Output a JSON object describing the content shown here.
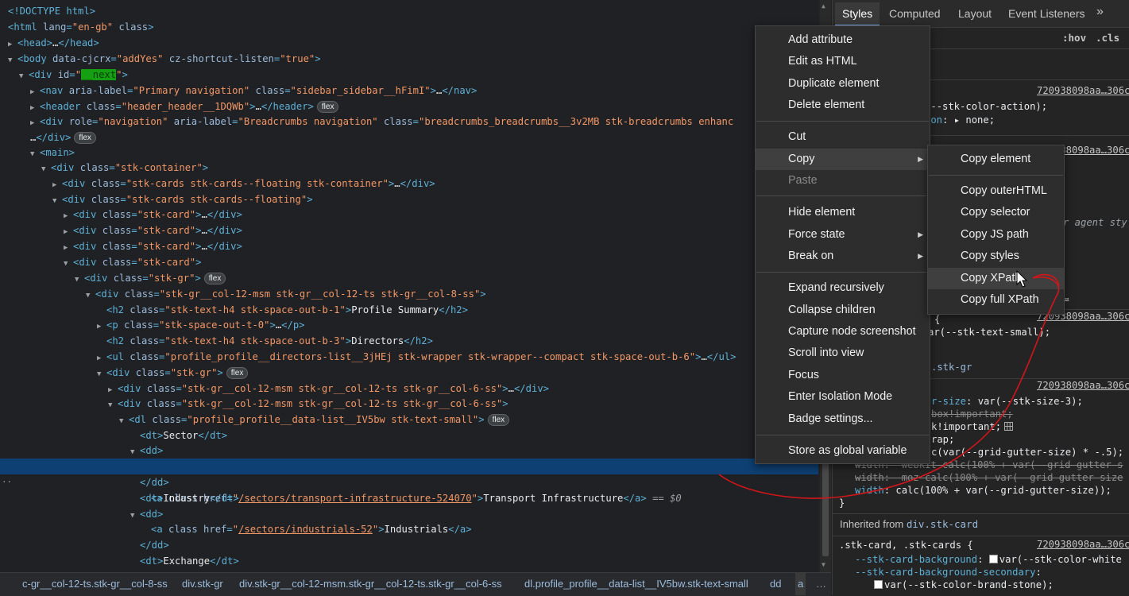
{
  "elements": {
    "lines": [
      {
        "t": "<!DOCTYPE html>"
      },
      {
        "t": "<html lang=\"en-gb\" class>"
      },
      {
        "t": "<head>…</head>"
      },
      {
        "t": "<body data-cjcrx=\"addYes\" cz-shortcut-listen=\"true\">"
      },
      {
        "t": "<div id=\"__next\">"
      },
      {
        "t": "<nav aria-label=\"Primary navigation\" class=\"sidebar_sidebar__hFimI\">…</nav>"
      },
      {
        "t": "<header class=\"header_header__1DQWb\">…</header>"
      },
      {
        "t": "<div role=\"navigation\" aria-label=\"Breadcrumbs navigation\" class=\"breadcrumbs_breadcrumbs__3v2MB stk-breadcrumbs enhanc"
      },
      {
        "t": "…</div>"
      },
      {
        "t": "<main>"
      },
      {
        "t": "<div class=\"stk-container\">"
      },
      {
        "t": "<div class=\"stk-cards stk-cards--floating stk-container\">…</div>"
      },
      {
        "t": "<div class=\"stk-cards stk-cards--floating\">"
      },
      {
        "t": "<div class=\"stk-card\">…</div>"
      },
      {
        "t": "<div class=\"stk-card\">…</div>"
      },
      {
        "t": "<div class=\"stk-card\">…</div>"
      },
      {
        "t": "<div class=\"stk-card\">"
      },
      {
        "t": "<div class=\"stk-gr\">"
      },
      {
        "t": "<div class=\"stk-gr__col-12-msm stk-gr__col-12-ts stk-gr__col-8-ss\">"
      },
      {
        "t": "<h2 class=\"stk-text-h4 stk-space-out-b-1\">Profile Summary</h2>"
      },
      {
        "t": "<p class=\"stk-space-out-t-0\">…</p>"
      },
      {
        "t": "<h2 class=\"stk-text-h4 stk-space-out-b-3\">Directors</h2>"
      },
      {
        "t": "<ul class=\"profile_profile__directors-list__3jHEj stk-wrapper stk-wrapper--compact stk-space-out-b-6\">…</ul>"
      },
      {
        "t": "<div class=\"stk-gr\">"
      },
      {
        "t": "<div class=\"stk-gr__col-12-msm stk-gr__col-12-ts stk-gr__col-6-ss\">…</div>"
      },
      {
        "t": "<div class=\"stk-gr__col-12-msm stk-gr__col-12-ts stk-gr__col-6-ss\">"
      },
      {
        "t": "<dl class=\"profile_profile__data-list__IV5bw stk-text-small\">"
      },
      {
        "t": "<dt>Sector</dt>"
      },
      {
        "t": "<dd>"
      },
      {
        "t": "<a class href=\"/sectors/transport-infrastructure-524070\">Transport Infrastructure</a> == $0"
      },
      {
        "t": "</dd>"
      },
      {
        "t": "<dt>Industry</dt>"
      },
      {
        "t": "<dd>"
      },
      {
        "t": "<a class href=\"/sectors/industrials-52\">Industrials</a>"
      },
      {
        "t": "</dd>"
      },
      {
        "t": "<dt>Exchange</dt>"
      }
    ],
    "flex_badge": "flex",
    "selected_marker": "== $0",
    "row_dots": "··"
  },
  "breadcrumbs": [
    "c-gr__col-12-ts.stk-gr__col-8-ss",
    "div.stk-gr",
    "div.stk-gr__col-12-msm.stk-gr__col-12-ts.stk-gr__col-6-ss",
    "dl.profile_profile__data-list__IV5bw.stk-text-small",
    "dd",
    "a",
    "…"
  ],
  "styles_panel": {
    "tabs": [
      "Styles",
      "Computed",
      "Layout",
      "Event Listeners",
      "»"
    ],
    "hov": ":hov",
    "cls": ".cls",
    "source": "720938098aa…306c",
    "rules": {
      "r1_l1": "(--stk-color-action);",
      "r1_l2_prop": "ion",
      "r1_l2_val": ": ▸ none;",
      "agent": "r agent sty",
      "trunc": "…",
      "r3_l1": "{",
      "r3_l2": "ar(--stk-text-small);",
      "stkgr": ".stk-gr",
      "r4_l1_prop": "r-size",
      "r4_l1_val": ": var(--stk-size-3);",
      "r4_l2": "box!important;",
      "r4_l3": "k!important;",
      "r4_l4": "rap;",
      "r4_l5": "c(var(--grid-gutter-size) * -.5);",
      "r4_l6": "width: -webkit-calc(100% + var(--grid-gutter-s",
      "r4_l7": "width: -moz-calc(100% + var(--grid-gutter-size",
      "r4_l8_prop": "width",
      "r4_l8_val": ": calc(100% + var(--grid-gutter-size));",
      "close": "}",
      "inherited_label": "Inherited from ",
      "inherited_link": "div.stk-card",
      "r5_sel": ".stk-card, .stk-cards {",
      "r5_l1_prop": "--stk-card-background",
      "r5_l1_val": "var(--stk-color-white",
      "r5_l2_prop": "--stk-card-background-secondary",
      "r5_l3_val": "var(--stk-color-brand-stone);"
    }
  },
  "context_menu": {
    "items": [
      "Add attribute",
      "Edit as HTML",
      "Duplicate element",
      "Delete element",
      "Cut",
      "Copy",
      "Paste",
      "Hide element",
      "Force state",
      "Break on",
      "Expand recursively",
      "Collapse children",
      "Capture node screenshot",
      "Scroll into view",
      "Focus",
      "Enter Isolation Mode",
      "Badge settings...",
      "Store as global variable"
    ],
    "submenu": [
      "Copy element",
      "Copy outerHTML",
      "Copy selector",
      "Copy JS path",
      "Copy styles",
      "Copy XPath",
      "Copy full XPath"
    ]
  },
  "colors": {
    "selected_row": "#0e4073",
    "annotation": "#d0161b",
    "menu_bg": "#2d2d2d"
  }
}
